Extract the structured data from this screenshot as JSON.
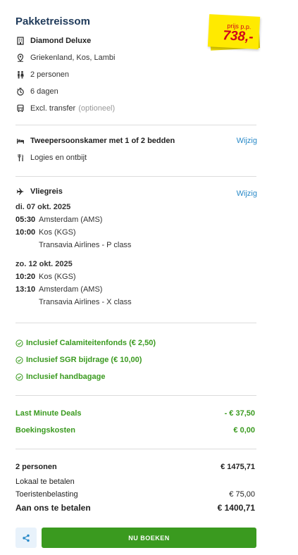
{
  "header": {
    "title": "Pakketreissom",
    "price_label": "prijs p.p.",
    "price": "738,-"
  },
  "summary": {
    "hotel": "Diamond Deluxe",
    "location": "Griekenland, Kos, Lambi",
    "persons": "2 personen",
    "duration": "6 dagen",
    "transfer": "Excl. transfer",
    "transfer_note": "(optioneel)"
  },
  "room": {
    "type": "Tweepersoonskamer met 1 of 2 bedden",
    "board": "Logies en ontbijt",
    "change_label": "Wijzig"
  },
  "flight": {
    "label": "Vliegreis",
    "change_label": "Wijzig",
    "outbound": {
      "date": "di. 07 okt. 2025",
      "dep_time": "05:30",
      "dep_place": "Amsterdam (AMS)",
      "arr_time": "10:00",
      "arr_place": "Kos (KGS)",
      "carrier": "Transavia Airlines - P class"
    },
    "return": {
      "date": "zo. 12 okt. 2025",
      "dep_time": "10:20",
      "dep_place": "Kos (KGS)",
      "arr_time": "13:10",
      "arr_place": "Amsterdam (AMS)",
      "carrier": "Transavia Airlines - X class"
    }
  },
  "inclusions": [
    "Inclusief Calamiteitenfonds (€ 2,50)",
    "Inclusief SGR bijdrage (€ 10,00)",
    "Inclusief handbagage"
  ],
  "discounts": {
    "lastminute_label": "Last Minute Deals",
    "lastminute_value": "- € 37,50",
    "booking_label": "Boekingskosten",
    "booking_value": "€ 0,00"
  },
  "totals": {
    "persons_label": "2 personen",
    "persons_value": "€ 1475,71",
    "local_label": "Lokaal te betalen",
    "tax_label": "Toeristenbelasting",
    "tax_value": "€ 75,00",
    "pay_label": "Aan ons te betalen",
    "pay_value": "€ 1400,71"
  },
  "actions": {
    "book_label": "NU BOEKEN"
  },
  "colors": {
    "accent_green": "#3a9a1f",
    "link_blue": "#2a8ac8",
    "price_yellow": "#ffea00",
    "price_red": "#d0021b"
  }
}
